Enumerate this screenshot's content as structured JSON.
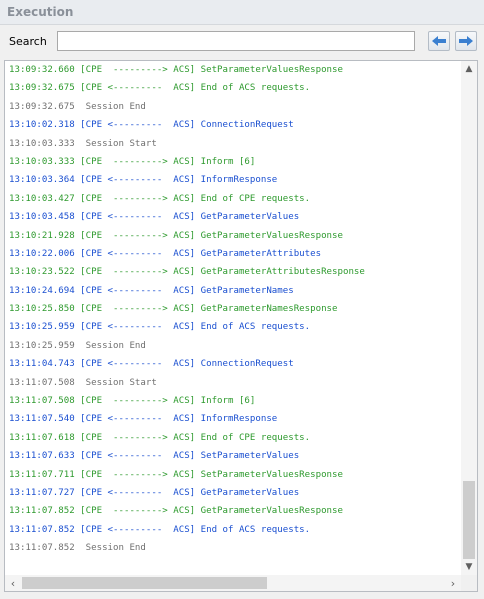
{
  "panel": {
    "title": "Execution"
  },
  "search": {
    "label": "Search",
    "value": "",
    "placeholder": ""
  },
  "colors": {
    "response": "#2e9a2e",
    "request": "#1a4fd0",
    "session": "#707070"
  },
  "log": [
    {
      "type": "response",
      "text": "13:09:32.660 [CPE  ---------> ACS] SetParameterValuesResponse"
    },
    {
      "type": "response",
      "text": "13:09:32.675 [CPE <---------  ACS] End of ACS requests."
    },
    {
      "type": "session",
      "text": "13:09:32.675  Session End"
    },
    {
      "type": "request",
      "text": "13:10:02.318 [CPE <---------  ACS] ConnectionRequest"
    },
    {
      "type": "session",
      "text": "13:10:03.333  Session Start"
    },
    {
      "type": "response",
      "text": "13:10:03.333 [CPE  ---------> ACS] Inform [6]"
    },
    {
      "type": "request",
      "text": "13:10:03.364 [CPE <---------  ACS] InformResponse"
    },
    {
      "type": "response",
      "text": "13:10:03.427 [CPE  ---------> ACS] End of CPE requests."
    },
    {
      "type": "request",
      "text": "13:10:03.458 [CPE <---------  ACS] GetParameterValues"
    },
    {
      "type": "response",
      "text": "13:10:21.928 [CPE  ---------> ACS] GetParameterValuesResponse"
    },
    {
      "type": "request",
      "text": "13:10:22.006 [CPE <---------  ACS] GetParameterAttributes"
    },
    {
      "type": "response",
      "text": "13:10:23.522 [CPE  ---------> ACS] GetParameterAttributesResponse"
    },
    {
      "type": "request",
      "text": "13:10:24.694 [CPE <---------  ACS] GetParameterNames"
    },
    {
      "type": "response",
      "text": "13:10:25.850 [CPE  ---------> ACS] GetParameterNamesResponse"
    },
    {
      "type": "request",
      "text": "13:10:25.959 [CPE <---------  ACS] End of ACS requests."
    },
    {
      "type": "session",
      "text": "13:10:25.959  Session End"
    },
    {
      "type": "request",
      "text": "13:11:04.743 [CPE <---------  ACS] ConnectionRequest"
    },
    {
      "type": "session",
      "text": "13:11:07.508  Session Start"
    },
    {
      "type": "response",
      "text": "13:11:07.508 [CPE  ---------> ACS] Inform [6]"
    },
    {
      "type": "request",
      "text": "13:11:07.540 [CPE <---------  ACS] InformResponse"
    },
    {
      "type": "response",
      "text": "13:11:07.618 [CPE  ---------> ACS] End of CPE requests."
    },
    {
      "type": "request",
      "text": "13:11:07.633 [CPE <---------  ACS] SetParameterValues"
    },
    {
      "type": "response",
      "text": "13:11:07.711 [CPE  ---------> ACS] SetParameterValuesResponse"
    },
    {
      "type": "request",
      "text": "13:11:07.727 [CPE <---------  ACS] GetParameterValues"
    },
    {
      "type": "response",
      "text": "13:11:07.852 [CPE  ---------> ACS] GetParameterValuesResponse"
    },
    {
      "type": "request",
      "text": "13:11:07.852 [CPE <---------  ACS] End of ACS requests."
    },
    {
      "type": "session",
      "text": "13:11:07.852  Session End"
    }
  ],
  "scrollbar": {
    "up_glyph": "▲",
    "down_glyph": "▼",
    "left_glyph": "‹",
    "right_glyph": "›"
  }
}
